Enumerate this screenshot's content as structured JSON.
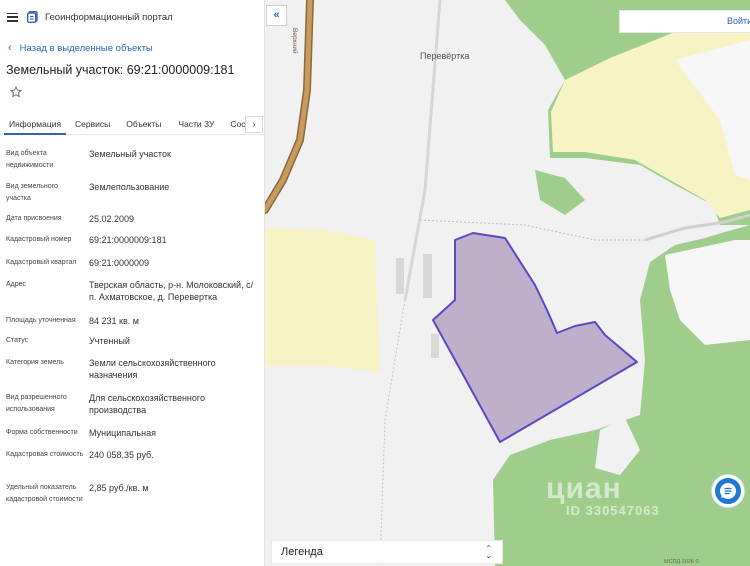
{
  "header": {
    "app_title": "Геоинформационный портал"
  },
  "nav": {
    "back_label": "Назад в выделенные объекты"
  },
  "object": {
    "title": "Земельный участок: 69:21:0000009:181"
  },
  "tabs": [
    {
      "label": "Информация",
      "active": true
    },
    {
      "label": "Сервисы",
      "active": false
    },
    {
      "label": "Объекты",
      "active": false
    },
    {
      "label": "Части ЗУ",
      "active": false
    },
    {
      "label": "Состав",
      "active": false
    }
  ],
  "tabs_next": "›",
  "info_rows": [
    {
      "label": "Вид объекта недвижимости",
      "value": "Земельный участок"
    },
    {
      "label": "Вид земельного участка",
      "value": "Землепользование"
    },
    {
      "label": "Дата присвоения",
      "value": "25.02.2009"
    },
    {
      "label": "Кадастровый номер",
      "value": "69:21:0000009:181"
    },
    {
      "label": "Кадастровый квартал",
      "value": "69:21:0000009"
    },
    {
      "label": "Адрес",
      "value": "Тверская область, р-н. Молоковский, с/п. Ахматовское, д. Перевертка"
    },
    {
      "label": "Площадь уточненная",
      "value": "84 231 кв. м"
    },
    {
      "label": "Статус",
      "value": "Учтенный"
    },
    {
      "label": "Категория земель",
      "value": "Земли сельскохозяйственного назначения"
    },
    {
      "label": "Вид разрешенного использования",
      "value": "Для сельскохозяйственного производства"
    },
    {
      "label": "Форма собственности",
      "value": "Муниципальная"
    },
    {
      "label": "Кадастровая стоимость",
      "value": "240 058,35 руб."
    },
    {
      "label": "Удельный показатель кадастровой стоимости",
      "value": "2,85 руб./кв. м"
    }
  ],
  "map": {
    "collapse_label": "«",
    "login_label": "Войти",
    "place_label": "Перевёртка",
    "road_label": "Верхний",
    "legend_label": "Легенда",
    "watermark": "циан",
    "watermark_id": "ID 330547063",
    "attribution": "МСПД 2026 ©",
    "colors": {
      "forest": "#9fce8c",
      "field": "#f7f3c4",
      "parcel_fill": "#b6a3c4",
      "parcel_stroke": "#5a48c4",
      "road": "#c89a5e",
      "accent": "#2c64b8",
      "chat": "#1f78d1"
    }
  },
  "icons": {
    "menu": "hamburger-icon",
    "logo": "document-logo-icon",
    "back": "chevron-left-icon",
    "favorite": "star-outline-icon",
    "chat": "chat-bubble-icon",
    "legend": "chevron-up-down-icon"
  }
}
